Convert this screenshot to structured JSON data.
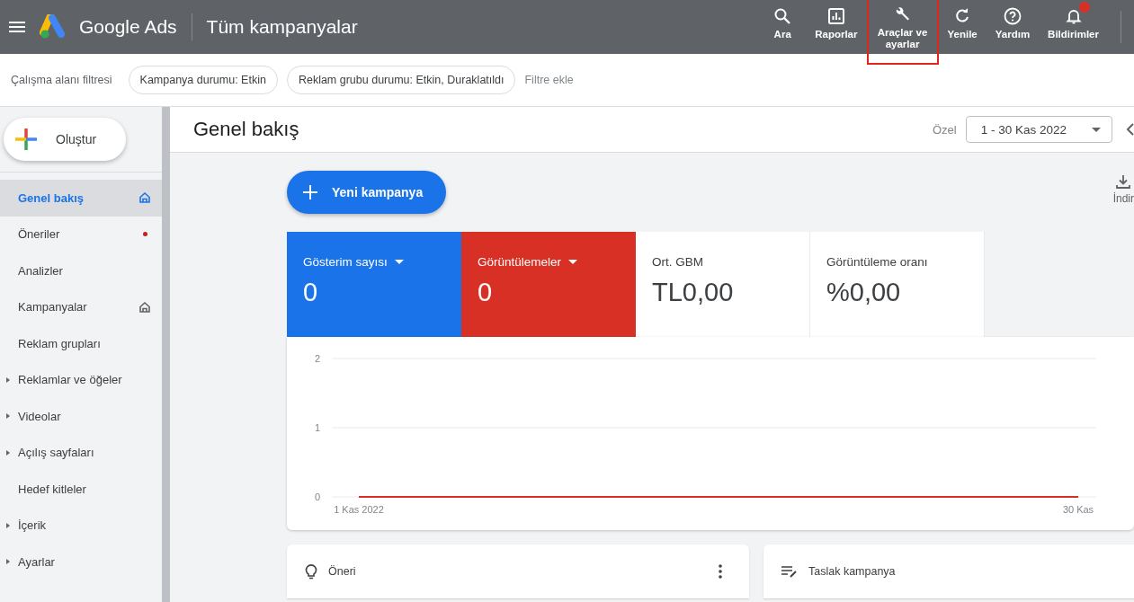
{
  "app": {
    "product": "Google Ads",
    "title": "Tüm kampanyalar"
  },
  "top_actions": [
    {
      "kind": "search",
      "label": "Ara",
      "highlighted": false
    },
    {
      "kind": "reports",
      "label": "Raporlar",
      "highlighted": false
    },
    {
      "kind": "tools",
      "label": "Araçlar ve ayarlar",
      "highlighted": true
    },
    {
      "kind": "refresh",
      "label": "Yenile",
      "highlighted": false
    },
    {
      "kind": "help",
      "label": "Yardım",
      "highlighted": false
    },
    {
      "kind": "notifications",
      "label": "Bildirimler",
      "highlighted": false,
      "alert": true
    }
  ],
  "filter_bar": {
    "label": "Çalışma alanı filtresi",
    "chips": [
      "Kampanya durumu: Etkin",
      "Reklam grubu durumu: Etkin, Duraklatıldı"
    ],
    "add_filter": "Filtre ekle"
  },
  "create_button": "Oluştur",
  "sidebar": {
    "items": [
      {
        "label": "Genel bakış",
        "selected": true,
        "expandable": false,
        "home": true,
        "dot": false
      },
      {
        "label": "Öneriler",
        "selected": false,
        "expandable": false,
        "home": false,
        "dot": true
      },
      {
        "label": "Analizler",
        "selected": false,
        "expandable": false,
        "home": false,
        "dot": false
      },
      {
        "label": "Kampanyalar",
        "selected": false,
        "expandable": false,
        "home": true,
        "dot": false
      },
      {
        "label": "Reklam grupları",
        "selected": false,
        "expandable": false,
        "home": false,
        "dot": false
      },
      {
        "label": "Reklamlar ve öğeler",
        "selected": false,
        "expandable": true,
        "home": false,
        "dot": false
      },
      {
        "label": "Videolar",
        "selected": false,
        "expandable": true,
        "home": false,
        "dot": false
      },
      {
        "label": "Açılış sayfaları",
        "selected": false,
        "expandable": true,
        "home": false,
        "dot": false
      },
      {
        "label": "Hedef kitleler",
        "selected": false,
        "expandable": false,
        "home": false,
        "dot": false
      },
      {
        "label": "İçerik",
        "selected": false,
        "expandable": true,
        "home": false,
        "dot": false
      },
      {
        "label": "Ayarlar",
        "selected": false,
        "expandable": true,
        "home": false,
        "dot": false
      }
    ]
  },
  "header": {
    "title": "Genel bakış",
    "range_label": "Özel",
    "date_range": "1 - 30 Kas 2022"
  },
  "new_campaign_button": "Yeni kampanya",
  "download_button": "İndir",
  "metrics": [
    {
      "label": "Gösterim sayısı",
      "value": "0",
      "selected": true,
      "color": "#1a73e8"
    },
    {
      "label": "Görüntülemeler",
      "value": "0",
      "selected": true,
      "color": "#d93025"
    },
    {
      "label": "Ort. GBM",
      "value": "TL0,00",
      "selected": false,
      "color": "#ffffff"
    },
    {
      "label": "Görüntüleme oranı",
      "value": "%0,00",
      "selected": false,
      "color": "#ffffff"
    }
  ],
  "chart_data": {
    "type": "line",
    "x": [
      "1 Kas 2022",
      "30 Kas"
    ],
    "ylim": [
      0,
      2
    ],
    "yticks": [
      0,
      1,
      2
    ],
    "series": [
      {
        "color": "#d93025",
        "values": [
          0,
          0
        ]
      }
    ]
  },
  "cards": [
    {
      "kind": "idea",
      "title": "Öneri"
    },
    {
      "kind": "draft",
      "title": "Taslak kampanya"
    }
  ]
}
